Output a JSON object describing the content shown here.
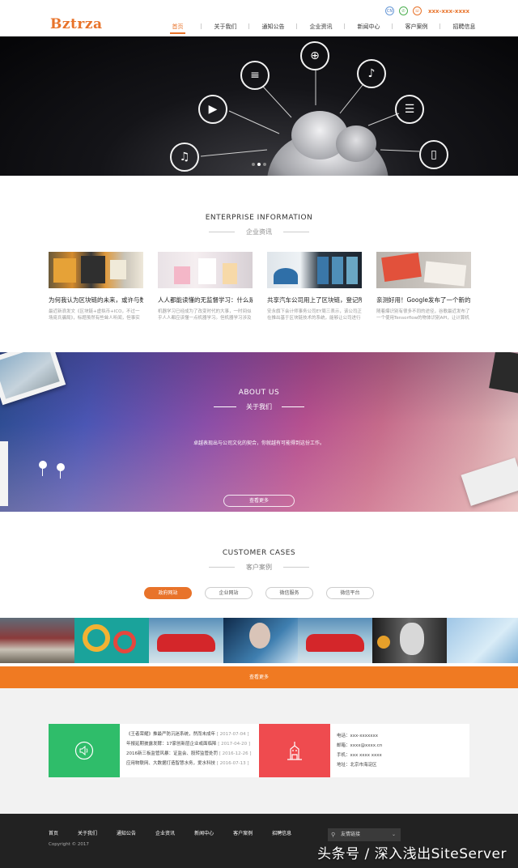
{
  "header": {
    "logo": "Bztrza",
    "lang_icon": "CN",
    "phone": "xxx-xxx-xxxx",
    "nav": [
      "首页",
      "关于我们",
      "通知公告",
      "企业资讯",
      "新闻中心",
      "客户案例",
      "招聘信息"
    ],
    "active_nav": 0
  },
  "colors": {
    "accent": "#e8732a",
    "green": "#2fbd6a",
    "red": "#ef4b4f",
    "footer": "#222222"
  },
  "banner": {
    "icons": [
      "music-icon",
      "video-icon",
      "document-icon",
      "globe-icon",
      "microphone-icon",
      "server-icon",
      "phone-icon"
    ]
  },
  "enterprise": {
    "title_en": "ENTERPRISE INFORMATION",
    "title_cn": "企业资讯",
    "items": [
      {
        "title": "为何我认为区块链的未来，或许与数",
        "desc": "最近新浪发文《区块链+虚拟币+ICO，不过一场庞氏骗局》，标题虽然有些耸人听闻，但事实"
      },
      {
        "title": "人人都能读懂的无监督学习：什么是",
        "desc": "机器学习已经成为了改变时代的大事，一时间似乎人人都应该懂一点机器学习。但机器学习涉及"
      },
      {
        "title": "共享汽车公司用上了区块链，登记所",
        "desc": "安永旗下会计师事务公司EY周三表示，该公司正在推出基于区块链技术的系统，能够让公司进行"
      },
      {
        "title": "亲测好用！Google发布了一个新的",
        "desc": "随着爆识别有很多不同的途径，谷歌最近发布了一个使用Tensorflow的物体识别API，让计算机"
      }
    ]
  },
  "about": {
    "title_en": "ABOUT US",
    "title_cn": "关于我们",
    "text": "卓越表现出与公司文化的契合，你就越有可能得到这份工作。",
    "button": "查看更多"
  },
  "cases": {
    "title_en": "CUSTOMER CASES",
    "title_cn": "客户案例",
    "tabs": [
      "政府网站",
      "企业网站",
      "微信服务",
      "微信平台"
    ],
    "active_tab": 0,
    "more": "查看更多"
  },
  "notices": [
    {
      "text": "《王者荣耀》推最严防沉迷系统，然而未成年",
      "date": "[ 2017-07-04 ]"
    },
    {
      "text": "年报延期披露发酵：17家创新层企业或面临降",
      "date": "[ 2017-04-20 ]"
    },
    {
      "text": "2016新三板监管风暴：证监会、股转监管处罚",
      "date": "[ 2016-12-26 ]"
    },
    {
      "text": "应用物联网、大数据打造智慧水务，爱水科技",
      "date": "[ 2016-07-13 ]"
    }
  ],
  "contact": [
    {
      "label": "电话：",
      "value": "xxx-xxxxxxx"
    },
    {
      "label": "邮箱：",
      "value": "xxxx@xxxx.cn"
    },
    {
      "label": "手机：",
      "value": "xxx xxxx xxxx"
    },
    {
      "label": "地址：",
      "value": "北京市海淀区"
    }
  ],
  "footer": {
    "nav": [
      "首页",
      "关于我们",
      "通知公告",
      "企业资讯",
      "新闻中心",
      "客户案例",
      "招聘信息"
    ],
    "copyright": "Copyright © 2017",
    "links_label": "友情链接"
  },
  "watermark": "头条号 / 深入浅出SiteServer"
}
